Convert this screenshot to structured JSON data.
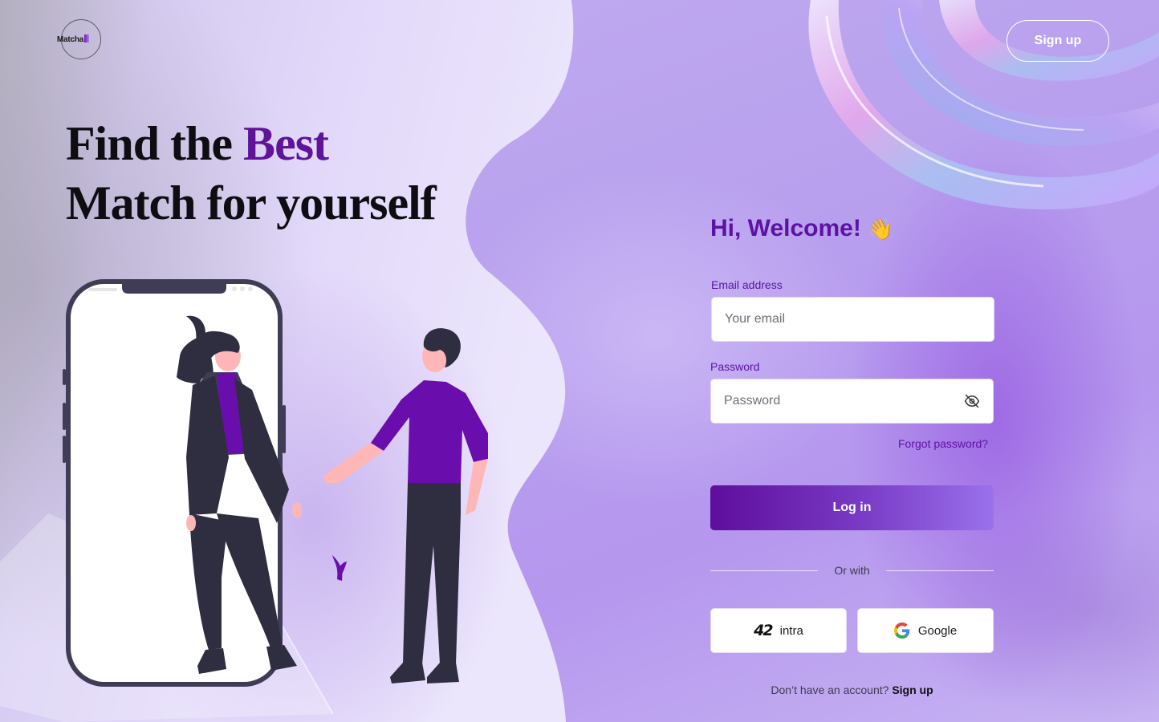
{
  "brand": {
    "logo_text": "Matcha",
    "logo_name": "matcha-logo"
  },
  "header": {
    "signup_label": "Sign up"
  },
  "hero": {
    "line1_prefix": "Find the ",
    "line1_accent": "Best",
    "line2": "Match for yourself"
  },
  "form": {
    "welcome": "Hi, Welcome!",
    "welcome_emoji": "👋",
    "email_label": "Email address",
    "email_placeholder": "Your email",
    "email_value": "",
    "password_label": "Password",
    "password_placeholder": "Password",
    "password_value": "",
    "forgot_label": "Forgot password?",
    "login_label": "Log in",
    "divider_label": "Or with",
    "intra_icon_text": "42",
    "intra_label": "intra",
    "google_label": "Google",
    "no_account_text": "Don’t have an account? ",
    "signup_link": "Sign up"
  },
  "colors": {
    "accent": "#5c12a3",
    "login_gradient_start": "#5e0d9c",
    "login_gradient_end": "#9a72ec",
    "background": "#c9b6f2"
  },
  "icons": {
    "password_toggle": "eye-off-icon",
    "intra": "42-intra-icon",
    "google": "google-icon",
    "wave": "waving-hand-emoji"
  }
}
